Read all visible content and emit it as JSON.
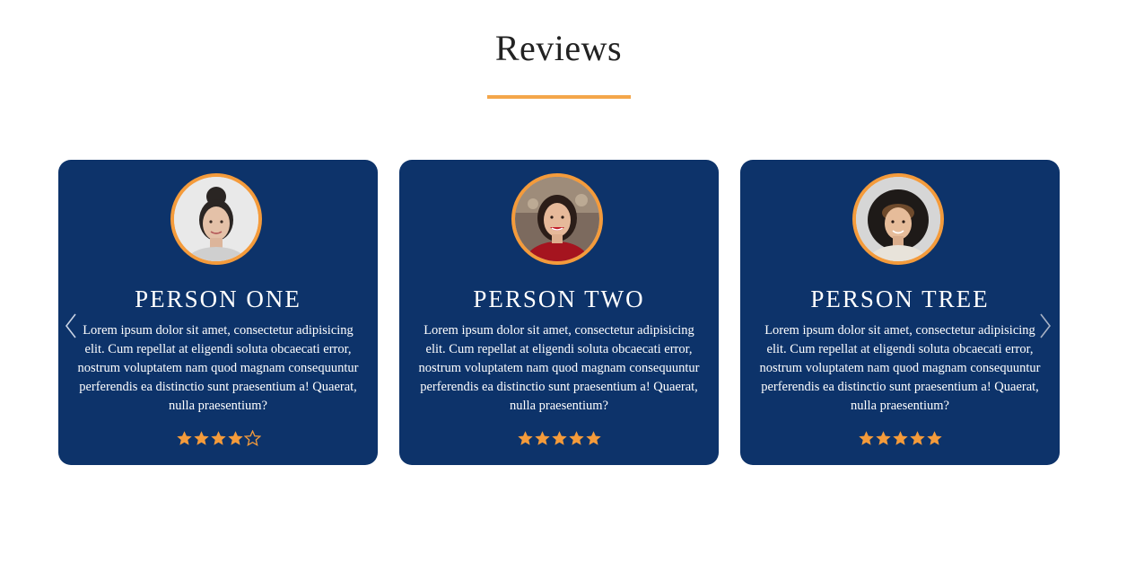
{
  "section": {
    "title": "Reviews",
    "accent_color": "#f4a64a"
  },
  "colors": {
    "card_background": "#0d336a",
    "avatar_border": "#f49b3b",
    "star_color": "#f49b3b"
  },
  "reviews": [
    {
      "name": "PERSON ONE",
      "text": "Lorem ipsum dolor sit amet, consectetur adipisicing elit. Cum repellat at eligendi soluta obcaecati error, nostrum voluptatem nam quod magnam consequuntur perferendis ea distinctio sunt praesentium a! Quaerat, nulla praesentium?",
      "rating": 4,
      "max_rating": 5,
      "avatar": "woman-with-bun-photo"
    },
    {
      "name": "PERSON TWO",
      "text": "Lorem ipsum dolor sit amet, consectetur adipisicing elit. Cum repellat at eligendi soluta obcaecati error, nostrum voluptatem nam quod magnam consequuntur perferendis ea distinctio sunt praesentium a! Quaerat, nulla praesentium?",
      "rating": 5,
      "max_rating": 5,
      "avatar": "smiling-woman-red-top-photo"
    },
    {
      "name": "PERSON TREE",
      "text": "Lorem ipsum dolor sit amet, consectetur adipisicing elit. Cum repellat at eligendi soluta obcaecati error, nostrum voluptatem nam quod magnam consequuntur perferendis ea distinctio sunt praesentium a! Quaerat, nulla praesentium?",
      "rating": 5,
      "max_rating": 5,
      "avatar": "man-with-hat-photo"
    }
  ],
  "carousel": {
    "prev_icon": "chevron-left-icon",
    "next_icon": "chevron-right-icon"
  }
}
